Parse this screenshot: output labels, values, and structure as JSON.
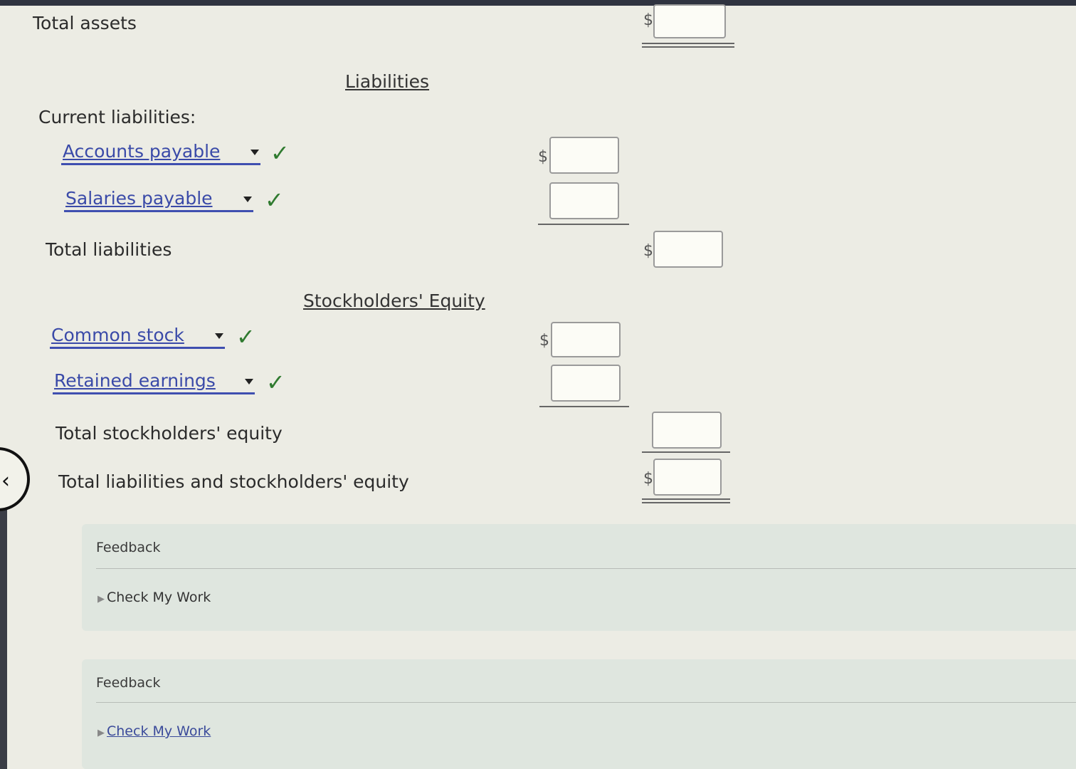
{
  "rows": {
    "total_assets": "Total assets",
    "current_liabilities": "Current liabilities:",
    "total_liabilities": "Total liabilities",
    "total_stockholders_equity": "Total stockholders' equity",
    "total_liabilities_and_equity": "Total liabilities and stockholders' equity"
  },
  "sections": {
    "liabilities": "Liabilities",
    "stockholders_equity": "Stockholders' Equity"
  },
  "dropdowns": [
    {
      "selected": "Accounts payable"
    },
    {
      "selected": "Salaries payable"
    },
    {
      "selected": "Common stock"
    },
    {
      "selected": "Retained earnings"
    }
  ],
  "check_mark": "✓",
  "currency_symbol": "$",
  "amounts": {
    "total_assets": "",
    "accounts_payable": "",
    "salaries_payable": "",
    "total_liabilities": "",
    "common_stock": "",
    "retained_earnings": "",
    "total_stockholders_equity": "",
    "total_liabilities_and_equity": ""
  },
  "feedback_panels": [
    {
      "title": "Feedback",
      "link": "Check My Work"
    },
    {
      "title": "Feedback",
      "link": "Check My Work"
    }
  ],
  "colors": {
    "link_blue": "#3a4aa8",
    "check_green": "#2f7a2f",
    "feedback_bg": "#dfe6df"
  }
}
